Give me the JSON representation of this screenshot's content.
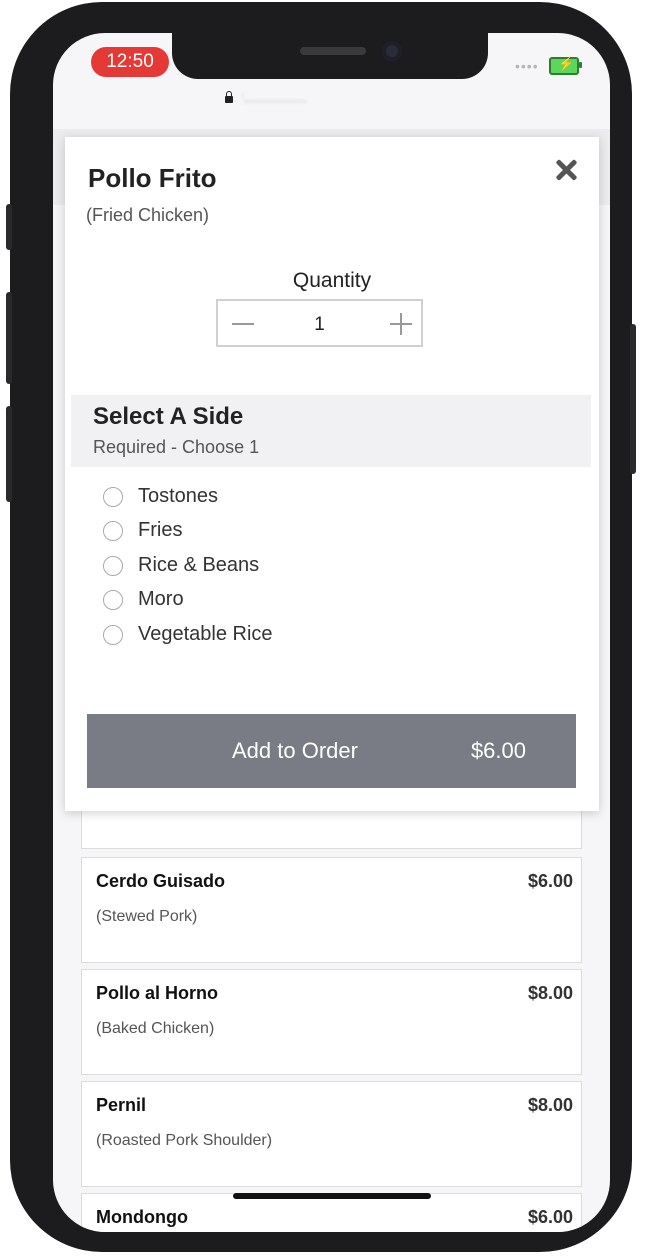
{
  "status_bar": {
    "time": "12:50",
    "signal": "••••"
  },
  "modal": {
    "title": "Pollo Frito",
    "subtitle": "(Fried Chicken)",
    "quantity_label": "Quantity",
    "quantity_value": "1",
    "section": {
      "title": "Select A Side",
      "subtitle": "Required - Choose 1",
      "options": [
        "Tostones",
        "Fries",
        "Rice & Beans",
        "Moro",
        "Vegetable Rice"
      ]
    },
    "add_button": {
      "label": "Add to Order",
      "price": "$6.00"
    }
  },
  "menu_items": [
    {
      "name": "Cerdo Guisado",
      "desc": "(Stewed Pork)",
      "price": "$6.00"
    },
    {
      "name": "Pollo al Horno",
      "desc": "(Baked Chicken)",
      "price": "$8.00"
    },
    {
      "name": "Pernil",
      "desc": "(Roasted Pork Shoulder)",
      "price": "$8.00"
    },
    {
      "name": "Mondongo",
      "desc": "",
      "price": "$6.00"
    }
  ],
  "colors": {
    "button_bg": "#7a7c85",
    "time_pill": "#e53935",
    "battery": "#5cd65c"
  }
}
